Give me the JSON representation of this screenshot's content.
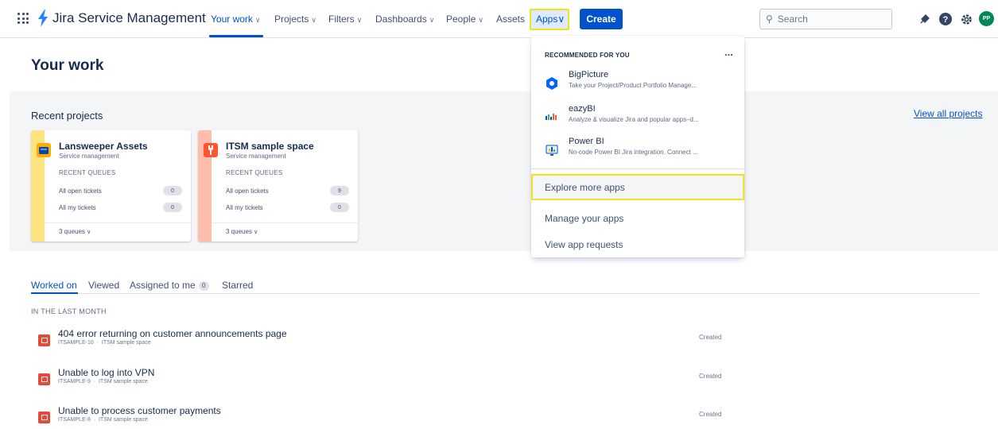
{
  "header": {
    "app_title": "Jira Service Management",
    "nav": {
      "your_work": "Your work",
      "projects": "Projects",
      "filters": "Filters",
      "dashboards": "Dashboards",
      "people": "People",
      "assets": "Assets",
      "apps": "Apps"
    },
    "create_label": "Create",
    "search_placeholder": "Search",
    "avatar_initials": "PP"
  },
  "page": {
    "title": "Your work",
    "recent_projects_title": "Recent projects",
    "view_all_projects": "View all projects"
  },
  "projects": [
    {
      "name": "Lansweeper Assets",
      "type": "Service management",
      "recent_queues_label": "RECENT QUEUES",
      "queues": [
        {
          "label": "All open tickets",
          "count": "0"
        },
        {
          "label": "All my tickets",
          "count": "0"
        }
      ],
      "footer": "3 queues",
      "stripe_color": "#FFE380"
    },
    {
      "name": "ITSM sample space",
      "type": "Service management",
      "recent_queues_label": "RECENT QUEUES",
      "queues": [
        {
          "label": "All open tickets",
          "count": "9"
        },
        {
          "label": "All my tickets",
          "count": "0"
        }
      ],
      "footer": "3 queues",
      "stripe_color": "#FFBDAD"
    }
  ],
  "work_tabs": {
    "worked_on": "Worked on",
    "viewed": "Viewed",
    "assigned_to_me": "Assigned to me",
    "assigned_count": "0",
    "starred": "Starred"
  },
  "section_label": "IN THE LAST MONTH",
  "work_items": [
    {
      "title": "404 error returning on customer announcements page",
      "key": "ITSAMPLE-10",
      "project": "ITSM sample space",
      "status": "Created"
    },
    {
      "title": "Unable to log into VPN",
      "key": "ITSAMPLE-9",
      "project": "ITSM sample space",
      "status": "Created"
    },
    {
      "title": "Unable to process customer payments",
      "key": "ITSAMPLE-8",
      "project": "ITSM sample space",
      "status": "Created"
    }
  ],
  "apps_menu": {
    "heading": "RECOMMENDED FOR YOU",
    "more": "...",
    "apps": [
      {
        "name": "BigPicture",
        "desc": "Take your Project/Product Portfolio Manage..."
      },
      {
        "name": "eazyBI",
        "desc": "Analyze & visualize Jira and popular apps–d..."
      },
      {
        "name": "Power BI",
        "desc": "No-code Power BI Jira integration. Connect ..."
      }
    ],
    "explore": "Explore more apps",
    "manage": "Manage your apps",
    "requests": "View app requests"
  },
  "colors": {
    "brand_blue": "#0052CC",
    "highlight_yellow": "#F0E41F",
    "issue_red": "#E5493A"
  }
}
